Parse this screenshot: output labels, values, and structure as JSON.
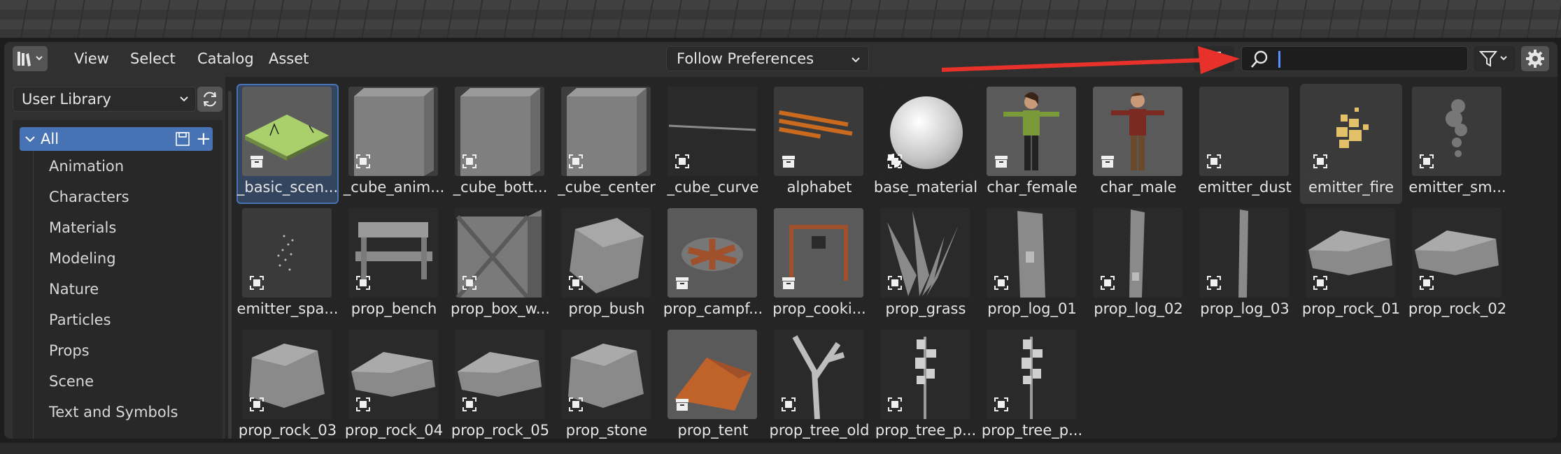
{
  "header": {
    "menus": [
      "View",
      "Select",
      "Catalog",
      "Asset"
    ],
    "display_mode": "Follow Preferences",
    "search": {
      "value": "",
      "placeholder": ""
    }
  },
  "sidebar": {
    "library": "User Library",
    "all_label": "All",
    "catalogs": [
      "Animation",
      "Characters",
      "Materials",
      "Modeling",
      "Nature",
      "Particles",
      "Props",
      "Scene",
      "Text and Symbols"
    ]
  },
  "assets": [
    {
      "name": "_basic_scen...",
      "kind": "scene",
      "selected": true
    },
    {
      "name": "_cube_anim...",
      "kind": "cube"
    },
    {
      "name": "_cube_bott...",
      "kind": "cube"
    },
    {
      "name": "_cube_center",
      "kind": "cube"
    },
    {
      "name": "_cube_curve",
      "kind": "curve"
    },
    {
      "name": "alphabet",
      "kind": "alphabet"
    },
    {
      "name": "base_material",
      "kind": "sphere"
    },
    {
      "name": "char_female",
      "kind": "female"
    },
    {
      "name": "char_male",
      "kind": "male"
    },
    {
      "name": "emitter_dust",
      "kind": "dust"
    },
    {
      "name": "emitter_fire",
      "kind": "fire",
      "hover": true
    },
    {
      "name": "emitter_sm...",
      "kind": "smoke"
    },
    {
      "name": "emitter_spa...",
      "kind": "spark"
    },
    {
      "name": "prop_bench",
      "kind": "bench"
    },
    {
      "name": "prop_box_w...",
      "kind": "box"
    },
    {
      "name": "prop_bush",
      "kind": "bush"
    },
    {
      "name": "prop_campf...",
      "kind": "campfire"
    },
    {
      "name": "prop_cooki...",
      "kind": "cooking"
    },
    {
      "name": "prop_grass",
      "kind": "grass"
    },
    {
      "name": "prop_log_01",
      "kind": "log1"
    },
    {
      "name": "prop_log_02",
      "kind": "log2"
    },
    {
      "name": "prop_log_03",
      "kind": "log3"
    },
    {
      "name": "prop_rock_01",
      "kind": "rock"
    },
    {
      "name": "prop_rock_02",
      "kind": "rock"
    },
    {
      "name": "prop_rock_03",
      "kind": "rock2"
    },
    {
      "name": "prop_rock_04",
      "kind": "rock"
    },
    {
      "name": "prop_rock_05",
      "kind": "rock"
    },
    {
      "name": "prop_stone",
      "kind": "rock2"
    },
    {
      "name": "prop_tent",
      "kind": "tent"
    },
    {
      "name": "prop_tree_old",
      "kind": "treeold"
    },
    {
      "name": "prop_tree_p...",
      "kind": "tree"
    },
    {
      "name": "prop_tree_p...",
      "kind": "tree"
    }
  ],
  "colors": {
    "accent": "#4772b3",
    "annotation_arrow": "#e8312a",
    "panel": "#303030"
  }
}
